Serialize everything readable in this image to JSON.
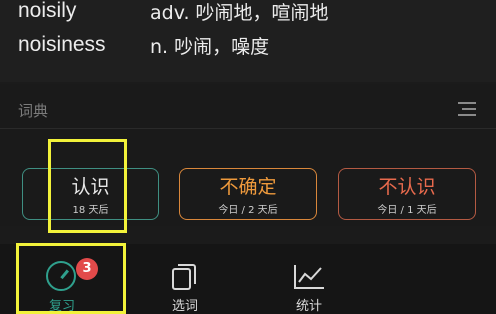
{
  "words": [
    {
      "word": "noisily",
      "definition": "adv. 吵闹地，喧闹地"
    },
    {
      "word": "noisiness",
      "definition": "n. 吵闹，噪度"
    }
  ],
  "dictionary": {
    "label": "词典",
    "menu_icon": "menu-icon"
  },
  "answers": {
    "know": {
      "label": "认识",
      "interval": "18 天后",
      "color": "#3f8f82"
    },
    "unsure": {
      "label": "不确定",
      "interval": "今日 / 2 天后",
      "color": "#ef9a3c"
    },
    "unknown": {
      "label": "不认识",
      "interval": "今日 / 1 天后",
      "color": "#e86a4d"
    }
  },
  "tabs": [
    {
      "label": "复习",
      "icon": "clock-icon",
      "badge": "3",
      "active": true
    },
    {
      "label": "选词",
      "icon": "cards-icon"
    },
    {
      "label": "统计",
      "icon": "chart-line-icon"
    }
  ],
  "colors": {
    "accent": "#2fa08d",
    "highlight": "#f2f23a",
    "badge": "#e24a4a",
    "background": "#1b1b1b"
  }
}
